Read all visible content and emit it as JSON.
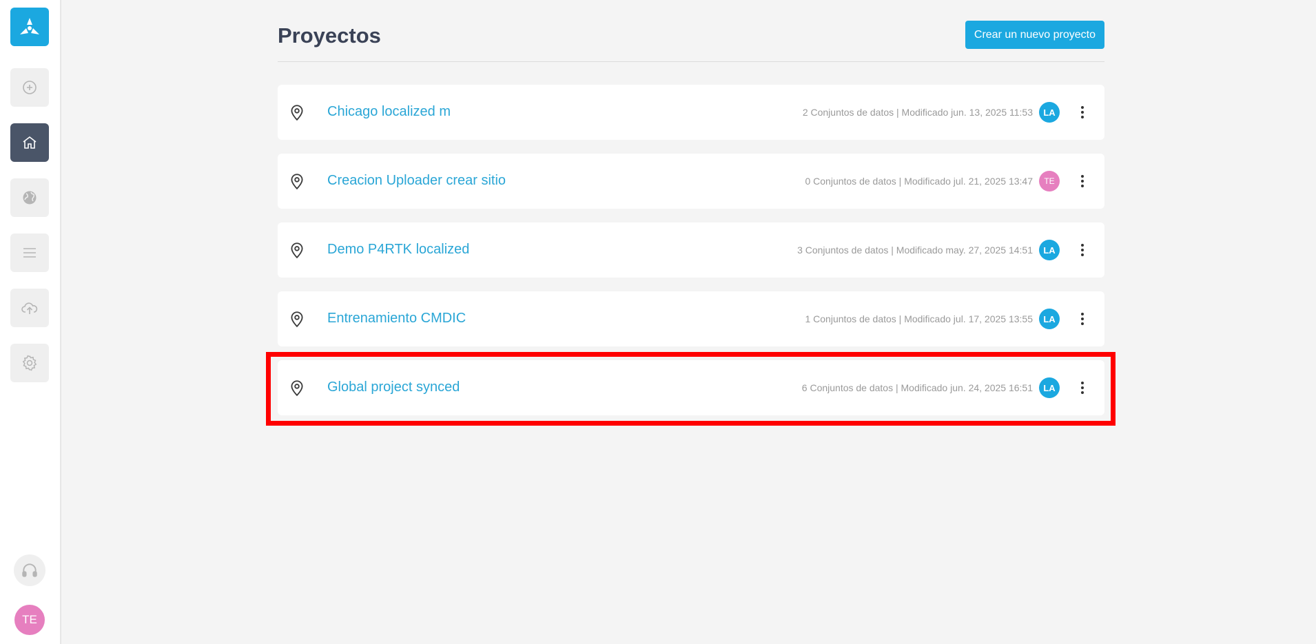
{
  "colors": {
    "accent": "#2aa6d6",
    "brand": "#1ba8e0",
    "sidebar_active": "#4a5568",
    "avatar_te": "#e67fbf",
    "avatar_la": "#1ba8e0",
    "highlight": "#ff0000"
  },
  "sidebar": {
    "logo_icon": "tri-blade-logo-icon",
    "items": [
      {
        "icon": "plus-circle-icon",
        "active": false
      },
      {
        "icon": "home-icon",
        "active": true
      },
      {
        "icon": "globe-icon",
        "active": false
      },
      {
        "icon": "list-icon",
        "active": false
      },
      {
        "icon": "cloud-upload-icon",
        "active": false
      },
      {
        "icon": "gear-icon",
        "active": false
      }
    ],
    "support_icon": "headset-icon",
    "user_initials": "TE"
  },
  "header": {
    "title": "Proyectos",
    "new_project_label": "Crear un nuevo proyecto"
  },
  "projects": [
    {
      "name": "Chicago localized m",
      "meta": "2 Conjuntos de datos | Modificado jun. 13, 2025 11:53",
      "owner": "LA"
    },
    {
      "name": "Creacion Uploader crear sitio",
      "meta": "0 Conjuntos de datos | Modificado jul. 21, 2025 13:47",
      "owner": "TE"
    },
    {
      "name": "Demo P4RTK localized",
      "meta": "3 Conjuntos de datos | Modificado may. 27, 2025 14:51",
      "owner": "LA"
    },
    {
      "name": "Entrenamiento CMDIC",
      "meta": "1 Conjuntos de datos | Modificado jul. 17, 2025 13:55",
      "owner": "LA"
    },
    {
      "name": "Global project synced",
      "meta": "6 Conjuntos de datos | Modificado jun. 24, 2025 16:51",
      "owner": "LA",
      "highlighted": true
    }
  ]
}
